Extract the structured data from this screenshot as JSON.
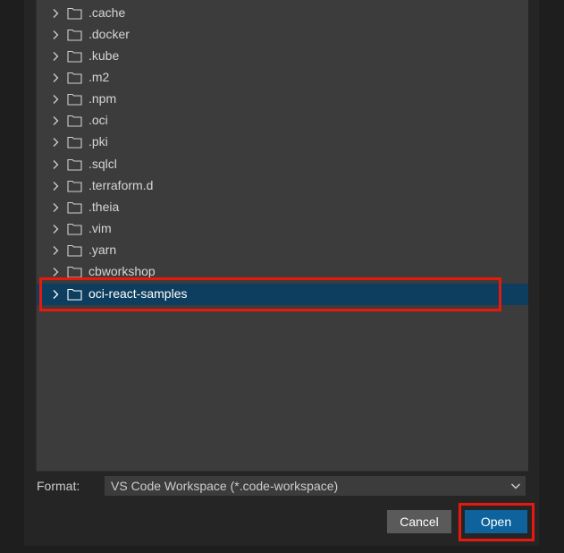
{
  "tree": {
    "items": [
      {
        "label": ".cache"
      },
      {
        "label": ".docker"
      },
      {
        "label": ".kube"
      },
      {
        "label": ".m2"
      },
      {
        "label": ".npm"
      },
      {
        "label": ".oci"
      },
      {
        "label": ".pki"
      },
      {
        "label": ".sqlcl"
      },
      {
        "label": ".terraform.d"
      },
      {
        "label": ".theia"
      },
      {
        "label": ".vim"
      },
      {
        "label": ".yarn"
      },
      {
        "label": "cbworkshop"
      },
      {
        "label": "oci-react-samples",
        "selected": true
      }
    ]
  },
  "format": {
    "label": "Format:",
    "value": "VS Code Workspace (*.code-workspace)"
  },
  "buttons": {
    "cancel_label": "Cancel",
    "open_label": "Open"
  },
  "colors": {
    "selection": "#0e3e5f",
    "primary_button": "#0e639c",
    "annotation": "#e7190f"
  }
}
